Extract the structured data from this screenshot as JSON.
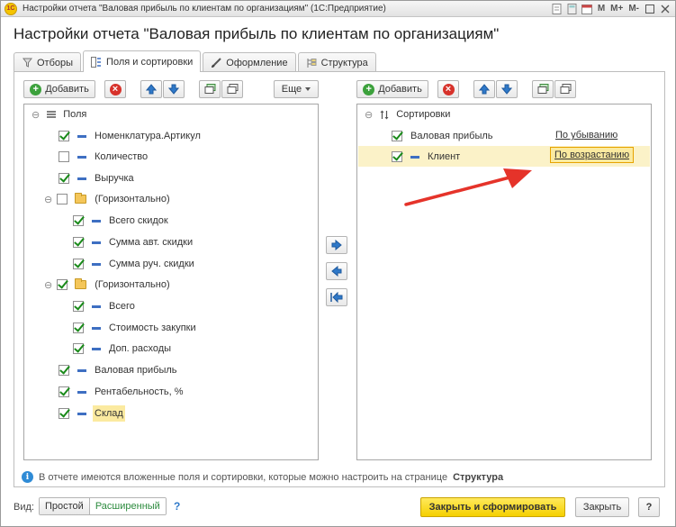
{
  "window": {
    "logo": "1С",
    "title": "Настройки отчета \"Валовая прибыль по клиентам по организациям\" (1С:Предприятие)",
    "toolbar_m": "M",
    "toolbar_mplus": "M+",
    "toolbar_mminus": "M-"
  },
  "heading": "Настройки отчета \"Валовая прибыль по клиентам по организациям\"",
  "tabs": [
    {
      "label": "Отборы",
      "icon": "filter-icon"
    },
    {
      "label": "Поля и сортировки",
      "icon": "fields-icon"
    },
    {
      "label": "Оформление",
      "icon": "brush-icon"
    },
    {
      "label": "Структура",
      "icon": "structure-icon"
    }
  ],
  "left_toolbar": {
    "add_label": "Добавить",
    "more_label": "Еще"
  },
  "fields_tree": {
    "root_label": "Поля",
    "items": [
      {
        "label": "Номенклатура.Артикул",
        "checked": true
      },
      {
        "label": "Количество",
        "checked": false
      },
      {
        "label": "Выручка",
        "checked": true
      },
      {
        "label": "(Горизонтально)",
        "checked": false
      },
      {
        "label": "Всего скидок",
        "checked": true
      },
      {
        "label": "Сумма авт. скидки",
        "checked": true
      },
      {
        "label": "Сумма руч. скидки",
        "checked": true
      },
      {
        "label": "(Горизонтально)",
        "checked": true
      },
      {
        "label": "Всего",
        "checked": true
      },
      {
        "label": "Стоимость закупки",
        "checked": true
      },
      {
        "label": "Доп. расходы",
        "checked": true
      },
      {
        "label": "Валовая прибыль",
        "checked": true
      },
      {
        "label": "Рентабельность, %",
        "checked": true
      },
      {
        "label": "Склад",
        "checked": true
      }
    ]
  },
  "right_toolbar": {
    "add_label": "Добавить"
  },
  "sort_tree": {
    "root_label": "Сортировки",
    "items": [
      {
        "label": "Валовая прибыль",
        "order": "По убыванию",
        "checked": true
      },
      {
        "label": "Клиент",
        "order": "По возрастанию",
        "checked": true
      }
    ]
  },
  "info_text": "В отчете имеются вложенные поля и сортировки, которые можно настроить на странице",
  "info_link": "Структура",
  "footer": {
    "view_label": "Вид:",
    "view_simple": "Простой",
    "view_extended": "Расширенный",
    "help": "?",
    "close_and_build": "Закрыть и сформировать",
    "close": "Закрыть",
    "help_button": "?"
  },
  "colors": {
    "accent_yellow": "#f5d000",
    "check_green": "#1a8a1a",
    "icon_blue": "#3e6fc2",
    "annotation_red": "#e5332a"
  }
}
